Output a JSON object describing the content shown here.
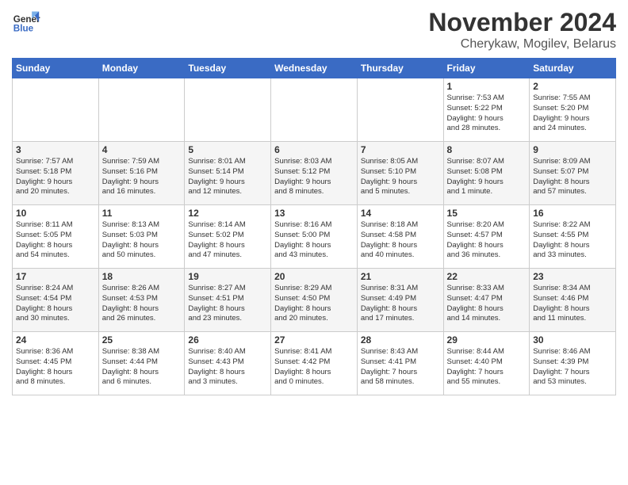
{
  "header": {
    "logo_line1": "General",
    "logo_line2": "Blue",
    "month": "November 2024",
    "location": "Cherykaw, Mogilev, Belarus"
  },
  "weekdays": [
    "Sunday",
    "Monday",
    "Tuesday",
    "Wednesday",
    "Thursday",
    "Friday",
    "Saturday"
  ],
  "weeks": [
    [
      {
        "day": "",
        "info": ""
      },
      {
        "day": "",
        "info": ""
      },
      {
        "day": "",
        "info": ""
      },
      {
        "day": "",
        "info": ""
      },
      {
        "day": "",
        "info": ""
      },
      {
        "day": "1",
        "info": "Sunrise: 7:53 AM\nSunset: 5:22 PM\nDaylight: 9 hours\nand 28 minutes."
      },
      {
        "day": "2",
        "info": "Sunrise: 7:55 AM\nSunset: 5:20 PM\nDaylight: 9 hours\nand 24 minutes."
      }
    ],
    [
      {
        "day": "3",
        "info": "Sunrise: 7:57 AM\nSunset: 5:18 PM\nDaylight: 9 hours\nand 20 minutes."
      },
      {
        "day": "4",
        "info": "Sunrise: 7:59 AM\nSunset: 5:16 PM\nDaylight: 9 hours\nand 16 minutes."
      },
      {
        "day": "5",
        "info": "Sunrise: 8:01 AM\nSunset: 5:14 PM\nDaylight: 9 hours\nand 12 minutes."
      },
      {
        "day": "6",
        "info": "Sunrise: 8:03 AM\nSunset: 5:12 PM\nDaylight: 9 hours\nand 8 minutes."
      },
      {
        "day": "7",
        "info": "Sunrise: 8:05 AM\nSunset: 5:10 PM\nDaylight: 9 hours\nand 5 minutes."
      },
      {
        "day": "8",
        "info": "Sunrise: 8:07 AM\nSunset: 5:08 PM\nDaylight: 9 hours\nand 1 minute."
      },
      {
        "day": "9",
        "info": "Sunrise: 8:09 AM\nSunset: 5:07 PM\nDaylight: 8 hours\nand 57 minutes."
      }
    ],
    [
      {
        "day": "10",
        "info": "Sunrise: 8:11 AM\nSunset: 5:05 PM\nDaylight: 8 hours\nand 54 minutes."
      },
      {
        "day": "11",
        "info": "Sunrise: 8:13 AM\nSunset: 5:03 PM\nDaylight: 8 hours\nand 50 minutes."
      },
      {
        "day": "12",
        "info": "Sunrise: 8:14 AM\nSunset: 5:02 PM\nDaylight: 8 hours\nand 47 minutes."
      },
      {
        "day": "13",
        "info": "Sunrise: 8:16 AM\nSunset: 5:00 PM\nDaylight: 8 hours\nand 43 minutes."
      },
      {
        "day": "14",
        "info": "Sunrise: 8:18 AM\nSunset: 4:58 PM\nDaylight: 8 hours\nand 40 minutes."
      },
      {
        "day": "15",
        "info": "Sunrise: 8:20 AM\nSunset: 4:57 PM\nDaylight: 8 hours\nand 36 minutes."
      },
      {
        "day": "16",
        "info": "Sunrise: 8:22 AM\nSunset: 4:55 PM\nDaylight: 8 hours\nand 33 minutes."
      }
    ],
    [
      {
        "day": "17",
        "info": "Sunrise: 8:24 AM\nSunset: 4:54 PM\nDaylight: 8 hours\nand 30 minutes."
      },
      {
        "day": "18",
        "info": "Sunrise: 8:26 AM\nSunset: 4:53 PM\nDaylight: 8 hours\nand 26 minutes."
      },
      {
        "day": "19",
        "info": "Sunrise: 8:27 AM\nSunset: 4:51 PM\nDaylight: 8 hours\nand 23 minutes."
      },
      {
        "day": "20",
        "info": "Sunrise: 8:29 AM\nSunset: 4:50 PM\nDaylight: 8 hours\nand 20 minutes."
      },
      {
        "day": "21",
        "info": "Sunrise: 8:31 AM\nSunset: 4:49 PM\nDaylight: 8 hours\nand 17 minutes."
      },
      {
        "day": "22",
        "info": "Sunrise: 8:33 AM\nSunset: 4:47 PM\nDaylight: 8 hours\nand 14 minutes."
      },
      {
        "day": "23",
        "info": "Sunrise: 8:34 AM\nSunset: 4:46 PM\nDaylight: 8 hours\nand 11 minutes."
      }
    ],
    [
      {
        "day": "24",
        "info": "Sunrise: 8:36 AM\nSunset: 4:45 PM\nDaylight: 8 hours\nand 8 minutes."
      },
      {
        "day": "25",
        "info": "Sunrise: 8:38 AM\nSunset: 4:44 PM\nDaylight: 8 hours\nand 6 minutes."
      },
      {
        "day": "26",
        "info": "Sunrise: 8:40 AM\nSunset: 4:43 PM\nDaylight: 8 hours\nand 3 minutes."
      },
      {
        "day": "27",
        "info": "Sunrise: 8:41 AM\nSunset: 4:42 PM\nDaylight: 8 hours\nand 0 minutes."
      },
      {
        "day": "28",
        "info": "Sunrise: 8:43 AM\nSunset: 4:41 PM\nDaylight: 7 hours\nand 58 minutes."
      },
      {
        "day": "29",
        "info": "Sunrise: 8:44 AM\nSunset: 4:40 PM\nDaylight: 7 hours\nand 55 minutes."
      },
      {
        "day": "30",
        "info": "Sunrise: 8:46 AM\nSunset: 4:39 PM\nDaylight: 7 hours\nand 53 minutes."
      }
    ]
  ]
}
